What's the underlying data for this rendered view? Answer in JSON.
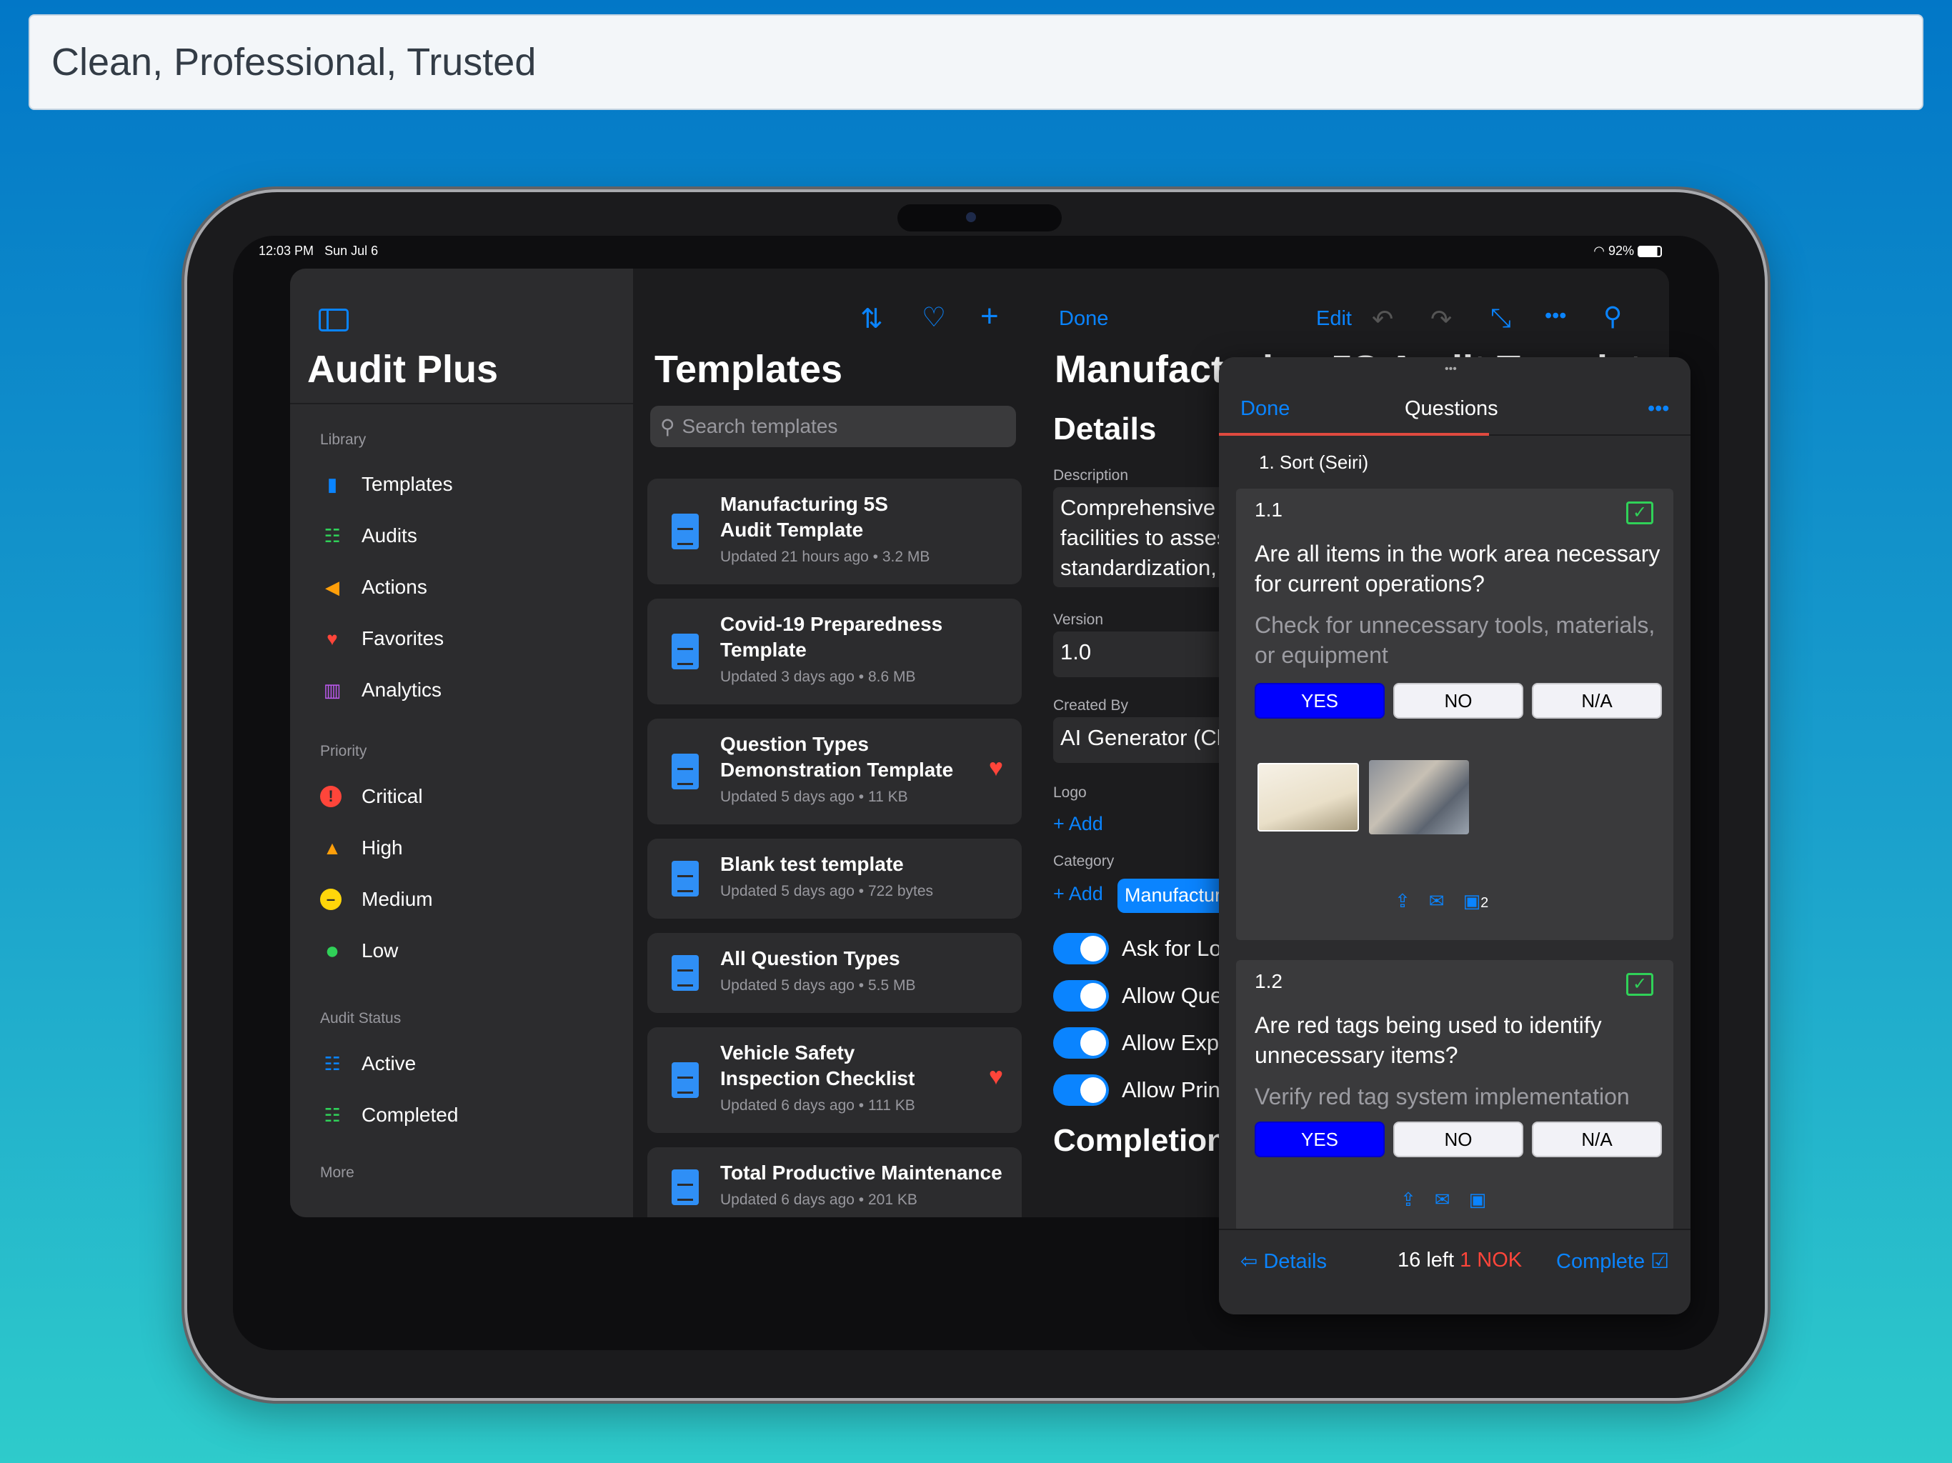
{
  "banner": {
    "text": "Clean, Professional, Trusted"
  },
  "status": {
    "time": "12:03 PM",
    "date": "Sun Jul 6",
    "battery": "92%"
  },
  "sidebar": {
    "title": "Audit Plus",
    "sections": [
      {
        "label": "Library",
        "items": [
          {
            "label": "Templates",
            "icon": "doc-icon",
            "color": "#0a84ff"
          },
          {
            "label": "Audits",
            "icon": "checklist-icon",
            "color": "#30d158"
          },
          {
            "label": "Actions",
            "icon": "megaphone-icon",
            "color": "#ff9f0a"
          },
          {
            "label": "Favorites",
            "icon": "heart-icon",
            "color": "#ff453a"
          },
          {
            "label": "Analytics",
            "icon": "chart-icon",
            "color": "#bf5af2"
          }
        ]
      },
      {
        "label": "Priority",
        "items": [
          {
            "label": "Critical",
            "icon": "exclamation-circle-icon",
            "color": "#ff453a"
          },
          {
            "label": "High",
            "icon": "warning-triangle-icon",
            "color": "#ff9f0a"
          },
          {
            "label": "Medium",
            "icon": "minus-circle-icon",
            "color": "#ffd60a"
          },
          {
            "label": "Low",
            "icon": "dot-circle-icon",
            "color": "#30d158"
          }
        ]
      },
      {
        "label": "Audit Status",
        "items": [
          {
            "label": "Active",
            "icon": "checklist-icon",
            "color": "#0a84ff"
          },
          {
            "label": "Completed",
            "icon": "checklist-icon",
            "color": "#30d158"
          }
        ]
      },
      {
        "label": "More",
        "items": []
      }
    ]
  },
  "templates": {
    "title": "Templates",
    "search_placeholder": "Search templates",
    "items": [
      {
        "name": "Manufacturing 5S\nAudit Template",
        "meta": "Updated 21 hours ago • 3.2 MB",
        "favorite": false
      },
      {
        "name": "Covid-19 Preparedness\nTemplate",
        "meta": "Updated 3 days ago • 8.6 MB",
        "favorite": false
      },
      {
        "name": "Question Types\nDemonstration Template",
        "meta": "Updated 5 days ago • 11 KB",
        "favorite": true
      },
      {
        "name": "Blank test template",
        "meta": "Updated 5 days ago • 722 bytes",
        "favorite": false
      },
      {
        "name": "All Question Types",
        "meta": "Updated 5 days ago • 5.5 MB",
        "favorite": false
      },
      {
        "name": "Vehicle Safety\nInspection Checklist",
        "meta": "Updated 6 days ago • 111 KB",
        "favorite": true
      },
      {
        "name": "Total Productive Maintenance",
        "meta": "Updated 6 days ago • 201 KB",
        "favorite": false
      }
    ]
  },
  "detail": {
    "done": "Done",
    "edit": "Edit",
    "title": "Manufacturing 5S Audit Template",
    "section": "Details",
    "description_label": "Description",
    "description": "Comprehensive\nfacilities to asses\nstandardization,",
    "version_label": "Version",
    "version": "1.0",
    "created_by_label": "Created By",
    "created_by": "AI Generator (Cl",
    "logo_label": "Logo",
    "add": "+ Add",
    "category_label": "Category",
    "category_chip": "Manufactur",
    "toggles": [
      "Ask for Lo",
      "Allow Que",
      "Allow Exp",
      "Allow Prin"
    ],
    "completion": "Completion"
  },
  "questions": {
    "done": "Done",
    "title": "Questions",
    "section": "1. Sort (Seiri)",
    "options": [
      "YES",
      "NO",
      "N/A"
    ],
    "items": [
      {
        "number": "1.1",
        "question": "Are all items in the work area necessary for current operations?",
        "hint": "Check for unnecessary tools, materials, or equipment",
        "selected": "YES",
        "photo_count": "2"
      },
      {
        "number": "1.2",
        "question": "Are red tags being used to identify unnecessary items?",
        "hint": "Verify red tag system implementation",
        "selected": "YES"
      }
    ],
    "footer": {
      "back": "Details",
      "left": "16 left",
      "nok": "1 NOK",
      "complete": "Complete"
    }
  }
}
